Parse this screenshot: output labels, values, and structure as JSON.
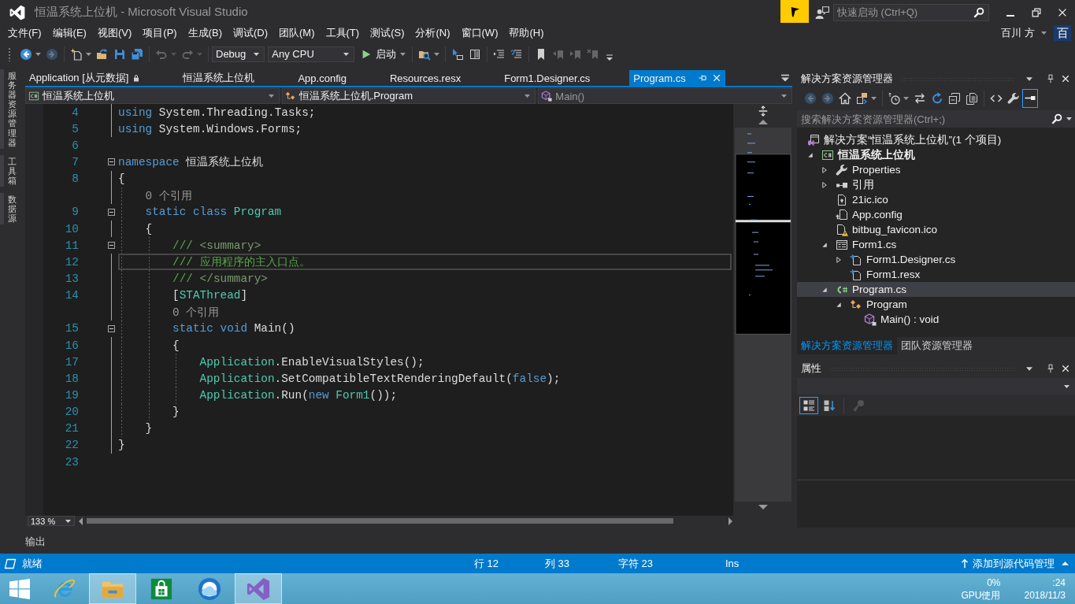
{
  "window": {
    "title": "恒温系统上位机 - Microsoft Visual Studio",
    "quick_launch": {
      "placeholder": "快速启动 (Ctrl+Q)"
    },
    "user": {
      "name": "百川 方",
      "initial": "百"
    }
  },
  "menu": [
    "文件(F)",
    "编辑(E)",
    "视图(V)",
    "项目(P)",
    "生成(B)",
    "调试(D)",
    "团队(M)",
    "工具(T)",
    "测试(S)",
    "分析(N)",
    "窗口(W)",
    "帮助(H)"
  ],
  "toolbar": {
    "groups": [
      [
        {
          "kind": "back",
          "disabled": false
        },
        {
          "kind": "forward",
          "disabled": true
        }
      ],
      [
        {
          "kind": "new-project",
          "disabled": false
        },
        {
          "kind": "open",
          "disabled": false
        },
        {
          "kind": "save",
          "disabled": false
        },
        {
          "kind": "save-all",
          "disabled": false
        }
      ],
      [
        {
          "kind": "undo",
          "disabled": true
        },
        {
          "kind": "redo",
          "disabled": true
        }
      ],
      [
        {
          "kind": "dropdown",
          "text": "Debug"
        },
        {
          "kind": "dropdown",
          "text": "Any CPU"
        },
        {
          "kind": "start",
          "text": "启动"
        }
      ],
      [
        {
          "kind": "find",
          "disabled": false
        }
      ],
      [
        {
          "kind": "step",
          "disabled": false
        },
        {
          "kind": "columns",
          "disabled": false
        }
      ],
      [
        {
          "kind": "outdent",
          "disabled": false
        },
        {
          "kind": "indent",
          "disabled": false
        }
      ],
      [
        {
          "kind": "bookmark",
          "disabled": false
        },
        {
          "kind": "prev-bookmark",
          "disabled": true
        },
        {
          "kind": "next-bookmark",
          "disabled": true
        },
        {
          "kind": "clear-bookmarks",
          "disabled": true
        }
      ]
    ]
  },
  "side_tabs": [
    "服务器资源管理器",
    "工具箱",
    "数据源"
  ],
  "document_tabs": [
    {
      "label": "Application [从元数据]",
      "selected": false,
      "locked": true
    },
    {
      "label": "恒温系统上位机",
      "selected": false,
      "locked": false
    },
    {
      "label": "App.config",
      "selected": false,
      "locked": false
    },
    {
      "label": "Resources.resx",
      "selected": false,
      "locked": false
    },
    {
      "label": "Form1.Designer.cs",
      "selected": false,
      "locked": false
    },
    {
      "label": "Program.cs",
      "selected": true,
      "locked": false
    }
  ],
  "navigation_bar": [
    {
      "kind": "project",
      "text": "恒温系统上位机",
      "disabled": false
    },
    {
      "kind": "class",
      "text": "恒温系统上位机.Program",
      "disabled": false
    },
    {
      "kind": "method",
      "text": "Main()",
      "disabled": true
    }
  ],
  "editor": {
    "zoom": "133 %",
    "lines": [
      {
        "kind": "code",
        "number": "4",
        "current": false,
        "tokens": [
          {
            "kind": "keyword",
            "text": "using"
          },
          {
            "kind": "plain",
            "text": " System.Threading.Tasks;"
          }
        ]
      },
      {
        "kind": "code",
        "number": "5",
        "current": false,
        "tokens": [
          {
            "kind": "keyword",
            "text": "using"
          },
          {
            "kind": "plain",
            "text": " System.Windows.Forms;"
          }
        ]
      },
      {
        "kind": "blank",
        "number": "6",
        "current": false
      },
      {
        "kind": "region",
        "number": "7",
        "current": false,
        "expanded": true,
        "tokens": [
          {
            "kind": "keyword",
            "text": "namespace"
          },
          {
            "kind": "plain",
            "text": " 恒温系统上位机"
          }
        ]
      },
      {
        "kind": "code",
        "number": "8",
        "current": false,
        "tokens": [
          {
            "kind": "plain",
            "text": "{"
          }
        ],
        "children": [
          {
            "kind": "codelens",
            "text": "0 个引用",
            "current": false
          },
          {
            "kind": "region",
            "number": "9",
            "current": false,
            "expanded": true,
            "tokens": [
              {
                "kind": "keyword",
                "text": "static class "
              },
              {
                "kind": "type",
                "text": "Program"
              }
            ]
          },
          {
            "kind": "code",
            "number": "10",
            "current": false,
            "tokens": [
              {
                "kind": "plain",
                "text": "{"
              }
            ],
            "children": [
              {
                "kind": "region",
                "number": "11",
                "current": false,
                "expanded": true,
                "tokens": [
                  {
                    "kind": "comment",
                    "text": "/// "
                  },
                  {
                    "kind": "doc-tag",
                    "text": "<summary>"
                  }
                ]
              },
              {
                "kind": "code",
                "number": "12",
                "current": true,
                "tokens": [
                  {
                    "kind": "comment",
                    "text": "/// 应用程序的主入口点。"
                  }
                ]
              },
              {
                "kind": "code",
                "number": "13",
                "current": false,
                "tokens": [
                  {
                    "kind": "comment",
                    "text": "/// "
                  },
                  {
                    "kind": "doc-tag",
                    "text": "</summary>"
                  }
                ]
              },
              {
                "kind": "code",
                "number": "14",
                "current": false,
                "tokens": [
                  {
                    "kind": "plain",
                    "text": "["
                  },
                  {
                    "kind": "type",
                    "text": "STAThread"
                  },
                  {
                    "kind": "plain",
                    "text": "]"
                  }
                ]
              },
              {
                "kind": "codelens",
                "text": "0 个引用",
                "current": false
              },
              {
                "kind": "region",
                "number": "15",
                "current": false,
                "expanded": true,
                "tokens": [
                  {
                    "kind": "keyword",
                    "text": "static void "
                  },
                  {
                    "kind": "plain",
                    "text": "Main()"
                  }
                ]
              },
              {
                "kind": "code",
                "number": "16",
                "current": false,
                "tokens": [
                  {
                    "kind": "plain",
                    "text": "{"
                  }
                ],
                "children": [
                  {
                    "kind": "code",
                    "number": "17",
                    "current": false,
                    "tokens": [
                      {
                        "kind": "type",
                        "text": "Application"
                      },
                      {
                        "kind": "plain",
                        "text": ".EnableVisualStyles();"
                      }
                    ]
                  },
                  {
                    "kind": "code",
                    "number": "18",
                    "current": false,
                    "tokens": [
                      {
                        "kind": "type",
                        "text": "Application"
                      },
                      {
                        "kind": "plain",
                        "text": ".SetCompatibleTextRenderingDefault("
                      },
                      {
                        "kind": "keyword",
                        "text": "false"
                      },
                      {
                        "kind": "plain",
                        "text": ");"
                      }
                    ]
                  },
                  {
                    "kind": "code",
                    "number": "19",
                    "current": false,
                    "tokens": [
                      {
                        "kind": "type",
                        "text": "Application"
                      },
                      {
                        "kind": "plain",
                        "text": ".Run("
                      },
                      {
                        "kind": "keyword",
                        "text": "new "
                      },
                      {
                        "kind": "type",
                        "text": "Form1"
                      },
                      {
                        "kind": "plain",
                        "text": "());"
                      }
                    ]
                  }
                ]
              },
              {
                "kind": "code",
                "number": "20",
                "current": false,
                "tokens": [
                  {
                    "kind": "plain",
                    "text": "}"
                  }
                ]
              }
            ]
          },
          {
            "kind": "code",
            "number": "21",
            "current": false,
            "tokens": [
              {
                "kind": "plain",
                "text": "}"
              }
            ]
          }
        ]
      },
      {
        "kind": "code",
        "number": "22",
        "current": false,
        "tokens": [
          {
            "kind": "plain",
            "text": "}"
          }
        ]
      },
      {
        "kind": "blank",
        "number": "23",
        "current": false
      }
    ]
  },
  "solution_explorer": {
    "title": "解决方案资源管理器",
    "toolbar": [
      [
        {
          "kind": "back",
          "disabled": true,
          "selected": false
        },
        {
          "kind": "forward",
          "disabled": true,
          "selected": false
        },
        {
          "kind": "home",
          "disabled": false,
          "selected": false
        },
        {
          "kind": "switch-views",
          "disabled": false,
          "selected": false
        }
      ],
      [
        {
          "kind": "history",
          "disabled": false,
          "selected": false
        },
        {
          "kind": "sync",
          "disabled": false,
          "selected": false
        },
        {
          "kind": "refresh",
          "disabled": false,
          "selected": false
        },
        {
          "kind": "collapse",
          "disabled": false,
          "selected": false
        },
        {
          "kind": "show-all",
          "disabled": false,
          "selected": false
        }
      ],
      [
        {
          "kind": "view-code",
          "disabled": false,
          "selected": false
        },
        {
          "kind": "properties",
          "disabled": false,
          "selected": false
        },
        {
          "kind": "preview",
          "disabled": false,
          "selected": true
        }
      ]
    ],
    "search": {
      "placeholder": "搜索解决方案资源管理器(Ctrl+;)"
    },
    "tree": [
      {
        "kind": "solution",
        "label": "解决方案“恒温系统上位机”(1 个项目)",
        "selected": false,
        "warning": false,
        "children": [
          {
            "kind": "csharp-project",
            "label": "恒温系统上位机",
            "selected": false,
            "warning": false,
            "expanded": true,
            "children": [
              {
                "kind": "properties",
                "label": "Properties",
                "selected": false,
                "warning": false,
                "expanded": false
              },
              {
                "kind": "references",
                "label": "引用",
                "selected": false,
                "warning": false,
                "expanded": false
              },
              {
                "kind": "icon-file",
                "label": "21ic.ico",
                "selected": false,
                "warning": false
              },
              {
                "kind": "config-file",
                "label": "App.config",
                "selected": false,
                "warning": false
              },
              {
                "kind": "file",
                "label": "bitbug_favicon.ico",
                "selected": false,
                "warning": true
              },
              {
                "kind": "form",
                "label": "Form1.cs",
                "selected": false,
                "warning": false,
                "expanded": true,
                "children": [
                  {
                    "kind": "dependent-file",
                    "label": "Form1.Designer.cs",
                    "selected": false,
                    "warning": false,
                    "expanded": false
                  },
                  {
                    "kind": "dependent-file",
                    "label": "Form1.resx",
                    "selected": false,
                    "warning": false
                  }
                ]
              },
              {
                "kind": "csharp-file",
                "label": "Program.cs",
                "selected": true,
                "warning": false,
                "expanded": true,
                "children": [
                  {
                    "kind": "class",
                    "label": "Program",
                    "selected": false,
                    "warning": false,
                    "expanded": true,
                    "children": [
                      {
                        "kind": "method",
                        "label": "Main() : void",
                        "selected": false,
                        "warning": false
                      }
                    ]
                  }
                ]
              }
            ]
          }
        ]
      }
    ],
    "tabs": [
      {
        "label": "解决方案资源管理器",
        "selected": true
      },
      {
        "label": "团队资源管理器",
        "selected": false
      }
    ]
  },
  "properties": {
    "title": "属性",
    "toolbar": [
      {
        "kind": "categorized",
        "selected": true,
        "disabled": false
      },
      {
        "kind": "alphabetical",
        "selected": false,
        "disabled": false
      },
      {
        "kind": "property-pages",
        "selected": false,
        "disabled": true
      }
    ]
  },
  "bottom_tabs": [
    "输出"
  ],
  "status_bar": {
    "message": "就绪",
    "line": "行 12",
    "column": "列 33",
    "character": "字符 23",
    "mode": "Ins",
    "source_control": "添加到源代码管理"
  },
  "taskbar": {
    "apps": [
      {
        "kind": "start",
        "active": false
      },
      {
        "kind": "browser",
        "active": false
      },
      {
        "kind": "explorer",
        "active": true
      },
      {
        "kind": "store",
        "active": false
      },
      {
        "kind": "cloud",
        "active": false
      },
      {
        "kind": "visual-studio",
        "active": true
      }
    ],
    "tray": {
      "gpu_usage": "0%",
      "gpu_label": "GPU使用",
      "time": ":24",
      "date": "2018/11/3"
    }
  }
}
